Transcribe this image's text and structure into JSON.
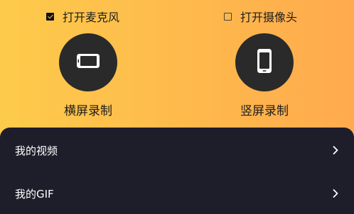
{
  "recording": {
    "mic_checkbox": {
      "label": "打开麦克风",
      "checked": true
    },
    "camera_checkbox": {
      "label": "打开摄像头",
      "checked": false
    },
    "landscape": {
      "label": "横屏录制",
      "icon": "phone-landscape-icon"
    },
    "portrait": {
      "label": "竖屏录制",
      "icon": "phone-portrait-icon"
    }
  },
  "menu": {
    "items": [
      {
        "label": "我的视频",
        "icon": "chevron-right-icon"
      },
      {
        "label": "我的GIF",
        "icon": "chevron-right-icon"
      }
    ]
  },
  "colors": {
    "gradient_start": "#FDCB4B",
    "gradient_end": "#FFAA4E",
    "circle": "#2a2a2a",
    "panel": "#1e1d2a"
  }
}
